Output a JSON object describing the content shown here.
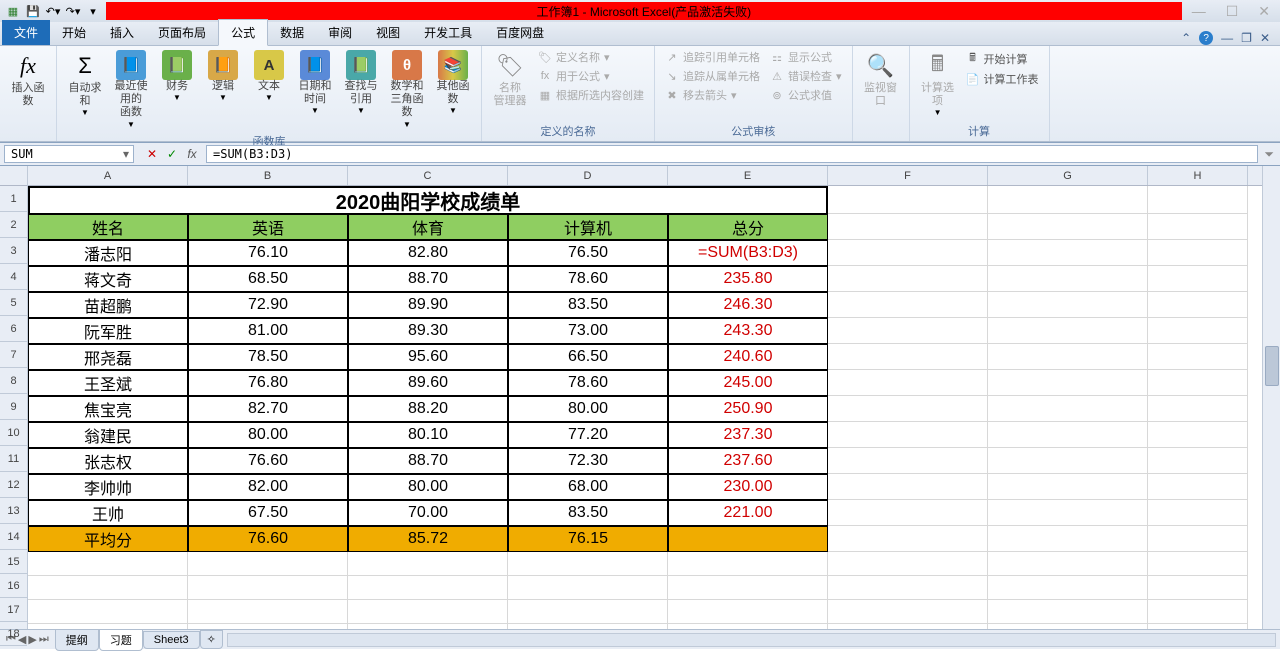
{
  "title": "工作簿1 - Microsoft Excel(产品激活失败)",
  "tabs": {
    "file": "文件",
    "t1": "开始",
    "t2": "插入",
    "t3": "页面布局",
    "t4": "公式",
    "t5": "数据",
    "t6": "审阅",
    "t7": "视图",
    "t8": "开发工具",
    "t9": "百度网盘"
  },
  "ribbon": {
    "fx": "插入函数",
    "lib": {
      "sum": "自动求和",
      "recent": "最近使用的\n函数",
      "fin": "财务",
      "logic": "逻辑",
      "text": "文本",
      "date": "日期和时间",
      "lookup": "查找与引用",
      "math": "数学和\n三角函数",
      "other": "其他函数",
      "label": "函数库"
    },
    "names": {
      "mgr": "名称\n管理器",
      "def": "定义名称",
      "use": "用于公式",
      "create": "根据所选内容创建",
      "label": "定义的名称"
    },
    "audit": {
      "prec": "追踪引用单元格",
      "dep": "追踪从属单元格",
      "rem": "移去箭头",
      "show": "显示公式",
      "err": "错误检查",
      "eval": "公式求值",
      "label": "公式审核"
    },
    "watch": "监视窗口",
    "calc": {
      "opts": "计算选项",
      "now": "开始计算",
      "sheet": "计算工作表",
      "label": "计算"
    }
  },
  "namebox": "SUM",
  "formula": "=SUM(B3:D3)",
  "cols": [
    "A",
    "B",
    "C",
    "D",
    "E",
    "F",
    "G",
    "H"
  ],
  "chart_data": {
    "type": "table",
    "title": "2020曲阳学校成绩单",
    "headers": [
      "姓名",
      "英语",
      "体育",
      "计算机",
      "总分"
    ],
    "rows": [
      [
        "潘志阳",
        "76.10",
        "82.80",
        "76.50",
        "=SUM(B3:D3)"
      ],
      [
        "蒋文奇",
        "68.50",
        "88.70",
        "78.60",
        "235.80"
      ],
      [
        "苗超鹏",
        "72.90",
        "89.90",
        "83.50",
        "246.30"
      ],
      [
        "阮军胜",
        "81.00",
        "89.30",
        "73.00",
        "243.30"
      ],
      [
        "邢尧磊",
        "78.50",
        "95.60",
        "66.50",
        "240.60"
      ],
      [
        "王圣斌",
        "76.80",
        "89.60",
        "78.60",
        "245.00"
      ],
      [
        "焦宝亮",
        "82.70",
        "88.20",
        "80.00",
        "250.90"
      ],
      [
        "翁建民",
        "80.00",
        "80.10",
        "77.20",
        "237.30"
      ],
      [
        "张志权",
        "76.60",
        "88.70",
        "72.30",
        "237.60"
      ],
      [
        "李帅帅",
        "82.00",
        "80.00",
        "68.00",
        "230.00"
      ],
      [
        "王帅",
        "67.50",
        "70.00",
        "83.50",
        "221.00"
      ]
    ],
    "avg_row": [
      "平均分",
      "76.60",
      "85.72",
      "76.15",
      ""
    ]
  },
  "sheets": {
    "s1": "提纲",
    "s2": "习题",
    "s3": "Sheet3"
  }
}
